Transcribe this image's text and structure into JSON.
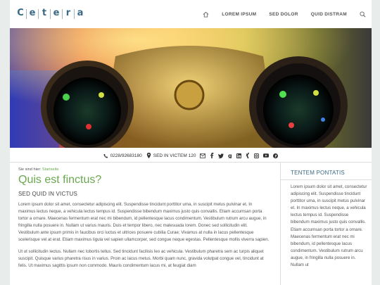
{
  "header": {
    "logo_letters": [
      "C",
      "e",
      "t",
      "e",
      "r",
      "a"
    ],
    "nav": [
      {
        "label": "LOREM IPSUM"
      },
      {
        "label": "SED DOLOR"
      },
      {
        "label": "QUID DISTRAM"
      }
    ],
    "icons": {
      "home": "home-icon",
      "search": "search-icon"
    }
  },
  "contact": {
    "phone": "0228/92683180",
    "location": "SED IN VICTEM 120",
    "social": [
      "mail-icon",
      "facebook-icon",
      "twitter-icon",
      "google-plus-icon",
      "linkedin-icon",
      "xing-icon",
      "instagram-icon",
      "youtube-icon",
      "pinterest-icon"
    ]
  },
  "breadcrumb": {
    "prefix": "Sie sind hier:",
    "link": "Startseite"
  },
  "main": {
    "title": "Quis est finctus?",
    "subtitle": "SED QUID IN VICTUS",
    "paragraph1": "Lorem ipsum dolor sit amet, consectetur adipiscing elit. Suspendisse tincidunt porttitor urna, in suscipit metus pulvinar et. In maximus lectus neque, a vehicula lectus tempus id. Suspendisse bibendum maximus justo quis convallis. Etiam accumsan porta tortor a ornare. Maecenas fermentum erat nec mi bibendum, id pellentesque lacus condimentum. Vestibulum rutrum arcu augue, in fringilla nulla posuere in. Nullam ut varius mauris. Duis et tempor libero, nec malesuada lorem. Donec sed sollicitudin elit. Vestibulum ante ipsum primis in faucibus orci luctus et ultrices posuere cubilia Curae; Vivamus at nulla in lacus pellentesque scelerisque vel at erat. Etiam maximus ligula vel sapien ullamcorper, sed congue neque egestas. Pellentesque mollis viverra sapien.",
    "paragraph2": "Ut ut sollicitudin lectus. Nullam nec lobortis tellus. Sed tincidunt facilisis leo ac vehicula. Vestibulum pharetra sem ac turpis aliquet suscipit. Quisque varius pharetra risus in varius. Proin ac lacus metus. Morbi quam nunc, gravida volutpat congue vel, tincidunt at felis. Ut maximus sagittis ipsum non commodo. Mauris condimentum lacus mi, at feugiat diam"
  },
  "sidebar": {
    "title": "TENTEM PONTATIS",
    "text": "Lorem ipsum dolor sit amet, consectetur adipiscing elit. Suspendisse tincidunt porttitor urna, in suscipit metus pulvinar et. In maximus lectus neque, a vehicula lectus tempus id. Suspendisse bibendum maximus justo quis convallis. Etiam accumsan porta tortor a ornare. Maecenas fermentum erat nec mi bibendum, id pellentesque lacus condimentum. Vestibulum rutrum arcu augue, in fringilla nulla posuere in. Nullam ut"
  },
  "colors": {
    "accent_green": "#6aa84f",
    "brand_blue": "#3b6a86"
  }
}
